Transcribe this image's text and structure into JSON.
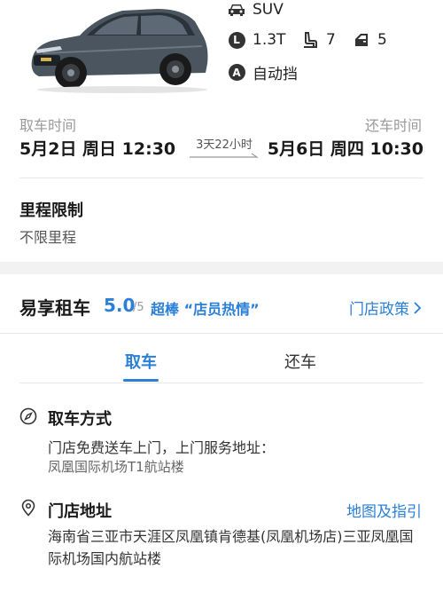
{
  "car": {
    "type": "SUV",
    "engine": "1.3T",
    "seats": "7",
    "doors": "5",
    "transmission": "自动挡",
    "engine_badge": "L",
    "transmission_badge": "A"
  },
  "trip": {
    "pickup_label": "取车时间",
    "pickup_time": "5月2日 周日 12:30",
    "return_label": "还车时间",
    "return_time": "5月6日 周四 10:30",
    "duration": "3天22小时"
  },
  "mileage": {
    "title": "里程限制",
    "value": "不限里程"
  },
  "store": {
    "name": "易享租车",
    "score": "5.0",
    "score_max": "/5",
    "badge": "超棒 “店员热情”",
    "policy_link": "门店政策"
  },
  "tabs": [
    {
      "label": "取车",
      "active": true
    },
    {
      "label": "还车",
      "active": false
    }
  ],
  "pickup": {
    "method_title": "取车方式",
    "method_desc": "门店免费送车上门，上门服务地址：",
    "method_location": "凤凰国际机场T1航站楼",
    "address_title": "门店地址",
    "map_link": "地图及指引",
    "address": "海南省三亚市天涯区凤凰镇肯德基(凤凰机场店)三亚凤凰国际机场国内航站楼"
  },
  "colors": {
    "accent": "#2a7fd8",
    "text": "#1a1a1a",
    "muted": "#999999",
    "divider": "#e8e8e8"
  },
  "icons": [
    "car-icon",
    "engine-icon",
    "seat-icon",
    "door-icon",
    "transmission-icon",
    "compass-icon",
    "location-pin-icon",
    "chevron-right-icon",
    "arrow-right-icon"
  ]
}
